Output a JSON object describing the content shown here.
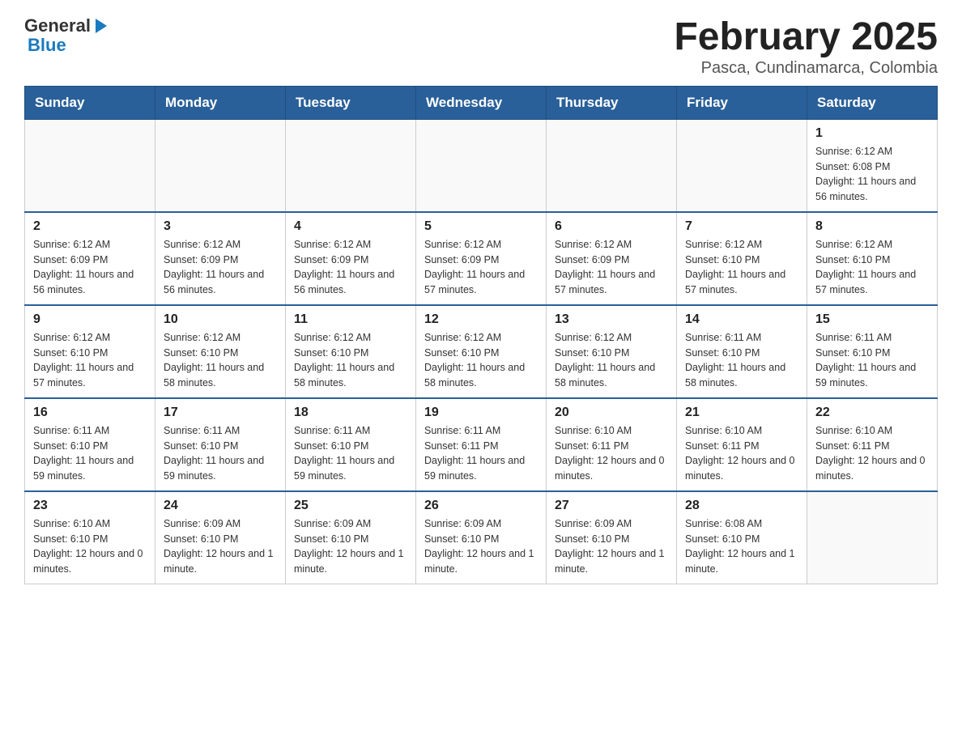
{
  "logo": {
    "text_general": "General",
    "text_blue": "Blue",
    "arrow": "▶"
  },
  "title": "February 2025",
  "subtitle": "Pasca, Cundinamarca, Colombia",
  "days_of_week": [
    "Sunday",
    "Monday",
    "Tuesday",
    "Wednesday",
    "Thursday",
    "Friday",
    "Saturday"
  ],
  "weeks": [
    [
      {
        "day": "",
        "info": ""
      },
      {
        "day": "",
        "info": ""
      },
      {
        "day": "",
        "info": ""
      },
      {
        "day": "",
        "info": ""
      },
      {
        "day": "",
        "info": ""
      },
      {
        "day": "",
        "info": ""
      },
      {
        "day": "1",
        "info": "Sunrise: 6:12 AM\nSunset: 6:08 PM\nDaylight: 11 hours and 56 minutes."
      }
    ],
    [
      {
        "day": "2",
        "info": "Sunrise: 6:12 AM\nSunset: 6:09 PM\nDaylight: 11 hours and 56 minutes."
      },
      {
        "day": "3",
        "info": "Sunrise: 6:12 AM\nSunset: 6:09 PM\nDaylight: 11 hours and 56 minutes."
      },
      {
        "day": "4",
        "info": "Sunrise: 6:12 AM\nSunset: 6:09 PM\nDaylight: 11 hours and 56 minutes."
      },
      {
        "day": "5",
        "info": "Sunrise: 6:12 AM\nSunset: 6:09 PM\nDaylight: 11 hours and 57 minutes."
      },
      {
        "day": "6",
        "info": "Sunrise: 6:12 AM\nSunset: 6:09 PM\nDaylight: 11 hours and 57 minutes."
      },
      {
        "day": "7",
        "info": "Sunrise: 6:12 AM\nSunset: 6:10 PM\nDaylight: 11 hours and 57 minutes."
      },
      {
        "day": "8",
        "info": "Sunrise: 6:12 AM\nSunset: 6:10 PM\nDaylight: 11 hours and 57 minutes."
      }
    ],
    [
      {
        "day": "9",
        "info": "Sunrise: 6:12 AM\nSunset: 6:10 PM\nDaylight: 11 hours and 57 minutes."
      },
      {
        "day": "10",
        "info": "Sunrise: 6:12 AM\nSunset: 6:10 PM\nDaylight: 11 hours and 58 minutes."
      },
      {
        "day": "11",
        "info": "Sunrise: 6:12 AM\nSunset: 6:10 PM\nDaylight: 11 hours and 58 minutes."
      },
      {
        "day": "12",
        "info": "Sunrise: 6:12 AM\nSunset: 6:10 PM\nDaylight: 11 hours and 58 minutes."
      },
      {
        "day": "13",
        "info": "Sunrise: 6:12 AM\nSunset: 6:10 PM\nDaylight: 11 hours and 58 minutes."
      },
      {
        "day": "14",
        "info": "Sunrise: 6:11 AM\nSunset: 6:10 PM\nDaylight: 11 hours and 58 minutes."
      },
      {
        "day": "15",
        "info": "Sunrise: 6:11 AM\nSunset: 6:10 PM\nDaylight: 11 hours and 59 minutes."
      }
    ],
    [
      {
        "day": "16",
        "info": "Sunrise: 6:11 AM\nSunset: 6:10 PM\nDaylight: 11 hours and 59 minutes."
      },
      {
        "day": "17",
        "info": "Sunrise: 6:11 AM\nSunset: 6:10 PM\nDaylight: 11 hours and 59 minutes."
      },
      {
        "day": "18",
        "info": "Sunrise: 6:11 AM\nSunset: 6:10 PM\nDaylight: 11 hours and 59 minutes."
      },
      {
        "day": "19",
        "info": "Sunrise: 6:11 AM\nSunset: 6:11 PM\nDaylight: 11 hours and 59 minutes."
      },
      {
        "day": "20",
        "info": "Sunrise: 6:10 AM\nSunset: 6:11 PM\nDaylight: 12 hours and 0 minutes."
      },
      {
        "day": "21",
        "info": "Sunrise: 6:10 AM\nSunset: 6:11 PM\nDaylight: 12 hours and 0 minutes."
      },
      {
        "day": "22",
        "info": "Sunrise: 6:10 AM\nSunset: 6:11 PM\nDaylight: 12 hours and 0 minutes."
      }
    ],
    [
      {
        "day": "23",
        "info": "Sunrise: 6:10 AM\nSunset: 6:10 PM\nDaylight: 12 hours and 0 minutes."
      },
      {
        "day": "24",
        "info": "Sunrise: 6:09 AM\nSunset: 6:10 PM\nDaylight: 12 hours and 1 minute."
      },
      {
        "day": "25",
        "info": "Sunrise: 6:09 AM\nSunset: 6:10 PM\nDaylight: 12 hours and 1 minute."
      },
      {
        "day": "26",
        "info": "Sunrise: 6:09 AM\nSunset: 6:10 PM\nDaylight: 12 hours and 1 minute."
      },
      {
        "day": "27",
        "info": "Sunrise: 6:09 AM\nSunset: 6:10 PM\nDaylight: 12 hours and 1 minute."
      },
      {
        "day": "28",
        "info": "Sunrise: 6:08 AM\nSunset: 6:10 PM\nDaylight: 12 hours and 1 minute."
      },
      {
        "day": "",
        "info": ""
      }
    ]
  ]
}
